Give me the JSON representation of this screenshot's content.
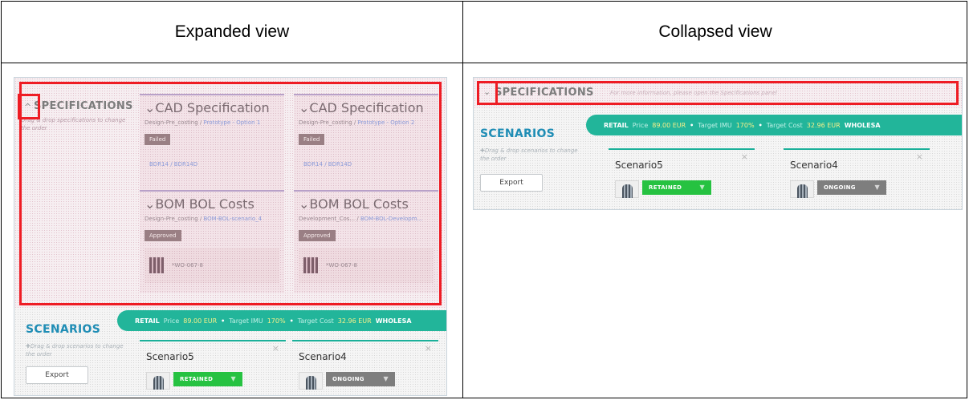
{
  "headers": {
    "expanded": "Expanded view",
    "collapsed": "Collapsed view"
  },
  "specifications": {
    "title": "SPECIFICATIONS",
    "hint": "Drag & drop specifications to change the order",
    "collapsed_hint": "For more information, please open the Specifications panel"
  },
  "spec_cards": [
    {
      "title": "CAD Specification",
      "sub_plain": "Design-Pre_costing / ",
      "sub_link": "Prototype - Option 1",
      "badge": "Failed",
      "link": "BDR14 / BDR14D"
    },
    {
      "title": "CAD Specification",
      "sub_plain": "Design-Pre_costing / ",
      "sub_link": "Prototype - Option 2",
      "badge": "Failed",
      "link": "BDR14 / BDR14D"
    },
    {
      "title": "BOM BOL Costs",
      "sub_plain": "Design-Pre_costing / ",
      "sub_link": "BOM-BOL-scenario_4",
      "badge": "Approved",
      "item": "*WO-067-8"
    },
    {
      "title": "BOM BOL Costs",
      "sub_plain": "Development_Cos... / ",
      "sub_link": "BOM-BOL-Developm...",
      "badge": "Approved",
      "item": "*WO-067-8"
    }
  ],
  "scenarios": {
    "title": "SCENARIOS",
    "hint": "Drag & drop scenarios to change the order",
    "export_label": "Export",
    "banner": {
      "retail": "RETAIL",
      "price_label": "Price",
      "price_value": "89.00 EUR",
      "imu_label": "Target IMU",
      "imu_value": "170%",
      "cost_label": "Target Cost",
      "cost_value": "32.96 EUR",
      "wholesale": "WHOLESA"
    },
    "cards": [
      {
        "name": "Scenario5",
        "status": "RETAINED"
      },
      {
        "name": "Scenario4",
        "status": "ONGOING"
      }
    ]
  },
  "icons": {
    "expand": "chevron-up-icon",
    "collapse": "chevron-down-icon",
    "close": "close-icon",
    "drag": "plus-icon",
    "dropdown": "caret-down-icon"
  },
  "colors": {
    "highlight": "#ee1c24",
    "banner": "#22b59a",
    "scenarios_title": "#1f8db5",
    "retained": "#26c241",
    "ongoing": "#7e7e7e"
  }
}
